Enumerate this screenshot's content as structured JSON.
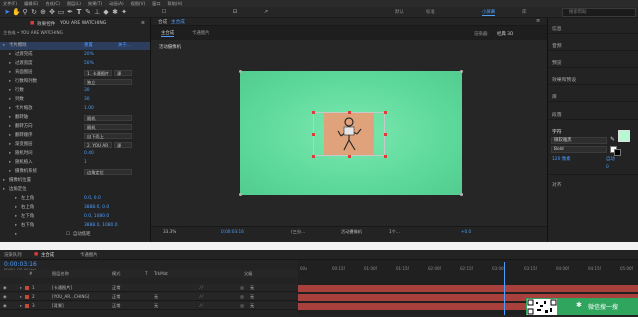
{
  "menubar": [
    "文件(F)",
    "编辑(E)",
    "合成(C)",
    "图层(L)",
    "效果(T)",
    "动画(A)",
    "视图(V)",
    "窗口",
    "帮助(H)"
  ],
  "toolbar": {
    "tools": [
      "selection-tool",
      "hand-tool",
      "zoom-tool",
      "rotate-tool",
      "camera-tool",
      "pan-behind-tool",
      "rectangle-tool",
      "pen-tool",
      "type-tool",
      "brush-tool",
      "clone-stamp-tool",
      "eraser-tool",
      "roto-brush-tool",
      "puppet-tool"
    ],
    "workspaces": [
      "默认",
      "标准",
      "小屏幕",
      "库"
    ],
    "active_workspace": "小屏幕",
    "search_placeholder": "搜索帮助"
  },
  "left_panel": {
    "tab_effects": "效果控件",
    "tab_effects_target": "YOU ARE WATCHING",
    "breadcrumb": "主合成 • YOU ARE WATCHING",
    "rows": [
      {
        "label": "卡片擦除",
        "value": "重置",
        "extra": "关于...",
        "indent": 1,
        "highlight": true
      },
      {
        "label": "过渡完成",
        "value": "20%",
        "indent": 2
      },
      {
        "label": "过渡宽度",
        "value": "50%",
        "indent": 2
      },
      {
        "label": "背面图层",
        "select": "1. 卡通图片",
        "select2": "源",
        "indent": 2
      },
      {
        "label": "行数和列数",
        "select": "独立",
        "indent": 2
      },
      {
        "label": "行数",
        "value": "30",
        "indent": 2
      },
      {
        "label": "列数",
        "value": "30",
        "indent": 2
      },
      {
        "label": "卡片缩放",
        "value": "1.00",
        "indent": 2
      },
      {
        "label": "翻转轴",
        "select": "随机",
        "indent": 2
      },
      {
        "label": "翻转方向",
        "select": "随机",
        "indent": 2
      },
      {
        "label": "翻转顺序",
        "select": "自下而上",
        "indent": 2
      },
      {
        "label": "渐变图层",
        "select": "2. YOU AR",
        "select2": "源",
        "indent": 2
      },
      {
        "label": "随机时间",
        "value": "0.40",
        "indent": 2
      },
      {
        "label": "随机植入",
        "value": "1",
        "indent": 2
      },
      {
        "label": "摄像机系统",
        "select": "边角定位",
        "indent": 2
      },
      {
        "label": "摄像机位置",
        "value": "",
        "indent": 1
      },
      {
        "label": "边角定位",
        "value": "",
        "indent": 1
      },
      {
        "label": "左上角",
        "value": "0.0, 0.0",
        "indent": 3
      },
      {
        "label": "右上角",
        "value": "3888.0, 0.0",
        "indent": 3
      },
      {
        "label": "左下角",
        "value": "0.0, 1080.0",
        "indent": 3
      },
      {
        "label": "右下角",
        "value": "3888.0, 1080.0",
        "indent": 3
      },
      {
        "label": "",
        "check": "自动焦距",
        "indent": 3
      }
    ]
  },
  "comp": {
    "tab_label": "合成",
    "tab_name": "主合成",
    "subtabs": [
      "主合成",
      "卡通图片"
    ],
    "renderer_label": "渲染器:",
    "renderer_value": "经典 3D",
    "active_camera": "活动摄像机",
    "view_bar": [
      "33.3%",
      "0:00:03:16",
      "(三分...",
      "活动摄像机",
      "1个...",
      "+0.0"
    ]
  },
  "right_panel": {
    "items": [
      "信息",
      "音频",
      "预览",
      "效果和预设",
      "库",
      "段落",
      "字符"
    ],
    "font_name": "微软雅黑",
    "font_style": "Bold",
    "font_size": "120 像素",
    "leading": "自动",
    "tracking": "0",
    "bottom_item": "对齐"
  },
  "timeline": {
    "tabs": [
      "渲染队列",
      "主合成",
      "卡通图片"
    ],
    "timecode": "0:00:03:16",
    "frame_info": "00001 (25.00 fps)",
    "columns": [
      "#",
      "图层名称",
      "模式",
      "T",
      "TrkMat",
      "父级"
    ],
    "ruler": [
      "00s",
      "00:15f",
      "01:00f",
      "01:15f",
      "02:00f",
      "02:15f",
      "03:00f",
      "03:15f",
      "04:00f",
      "04:15f",
      "05:00f"
    ],
    "layers": [
      {
        "num": "1",
        "name": "[卡通图片]",
        "mode": "正常",
        "trk": "",
        "parent": "无",
        "color": "#c44a3a"
      },
      {
        "num": "2",
        "name": "[YOU_AR...CHING]",
        "mode": "正常",
        "trk": "无",
        "parent": "无",
        "color": "#c44a3a"
      },
      {
        "num": "3",
        "name": "[背景]",
        "mode": "正常",
        "trk": "无",
        "parent": "无",
        "color": "#c44a3a"
      }
    ],
    "wechat_label": "微信搜一搜"
  }
}
